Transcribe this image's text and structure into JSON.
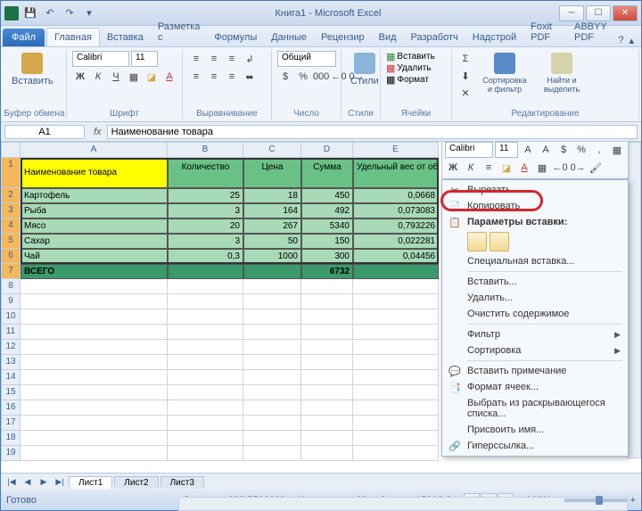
{
  "title": "Книга1 - Microsoft Excel",
  "file_tab": "Файл",
  "tabs": [
    "Главная",
    "Вставка",
    "Разметка с",
    "Формулы",
    "Данные",
    "Рецензир",
    "Вид",
    "Разработч",
    "Надстрой",
    "Foxit PDF",
    "ABBYY PDF"
  ],
  "ribbon": {
    "clipboard": {
      "label": "Буфер обмена",
      "paste": "Вставить"
    },
    "font": {
      "label": "Шрифт",
      "name": "Calibri",
      "size": "11"
    },
    "align": {
      "label": "Выравнивание"
    },
    "number": {
      "label": "Число",
      "format": "Общий"
    },
    "styles": {
      "label": "Стили",
      "btn": "Стили"
    },
    "cells": {
      "label": "Ячейки",
      "insert": "Вставить",
      "delete": "Удалить",
      "format": "Формат"
    },
    "editing": {
      "label": "Редактирование",
      "sort": "Сортировка и фильтр",
      "find": "Найти и выделить"
    }
  },
  "namebox": "A1",
  "fx": "fx",
  "formula_value": "Наименование товара",
  "cols": {
    "A": 165,
    "B": 85,
    "C": 65,
    "D": 58,
    "E": 96
  },
  "headers": {
    "A": "Наименование товара",
    "B": "Количество",
    "C": "Цена",
    "D": "Сумма",
    "E": "Удельный вес от общей суммы"
  },
  "data_rows": [
    {
      "n": "2",
      "A": "Картофель",
      "B": "25",
      "C": "18",
      "D": "450",
      "E": "0,0668"
    },
    {
      "n": "3",
      "A": "Рыба",
      "B": "3",
      "C": "164",
      "D": "492",
      "E": "0,073083"
    },
    {
      "n": "4",
      "A": "Мясо",
      "B": "20",
      "C": "267",
      "D": "5340",
      "E": "0,793226"
    },
    {
      "n": "5",
      "A": "Сахар",
      "B": "3",
      "C": "50",
      "D": "150",
      "E": "0,022281"
    },
    {
      "n": "6",
      "A": "Чай",
      "B": "0,3",
      "C": "1000",
      "D": "300",
      "E": "0,04456"
    }
  ],
  "total_row": {
    "n": "7",
    "A": "ВСЕГО",
    "D": "6732"
  },
  "mini_toolbar": {
    "font": "Calibri",
    "size": "11"
  },
  "context_menu": {
    "cut": "Вырезать",
    "copy": "Копировать",
    "paste_options_label": "Параметры вставки:",
    "paste_special": "Специальная вставка...",
    "insert": "Вставить...",
    "delete": "Удалить...",
    "clear": "Очистить содержимое",
    "filter": "Фильтр",
    "sort": "Сортировка",
    "comment": "Вставить примечание",
    "format_cells": "Формат ячеек...",
    "dropdown": "Выбрать из раскрывающегося списка...",
    "name": "Присвоить имя...",
    "hyperlink": "Гиперссылка..."
  },
  "sheets": [
    "Лист1",
    "Лист2",
    "Лист3"
  ],
  "status": {
    "ready": "Готово",
    "avg_label": "Среднее:",
    "avg": "682,5590909",
    "count_label": "Количество:",
    "count": "33",
    "sum_label": "Сумма:",
    "sum": "15016,3",
    "zoom": "100%"
  }
}
